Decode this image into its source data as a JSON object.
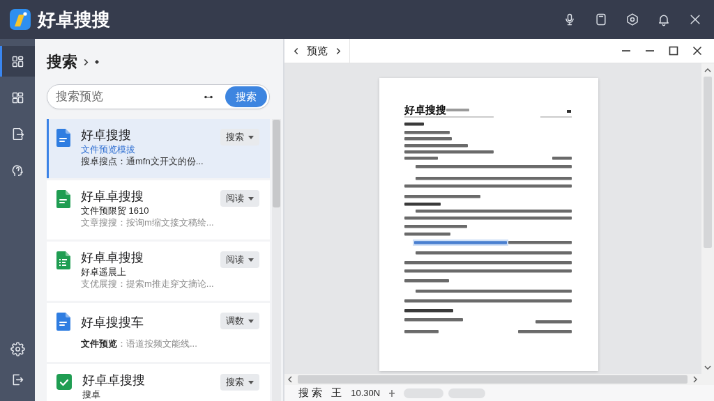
{
  "window": {
    "title": "好卓搜搜"
  },
  "sidebar": {
    "items": [
      {
        "kind": "dashboard",
        "selected": true
      },
      {
        "kind": "layout",
        "selected": false
      },
      {
        "kind": "export",
        "selected": false
      },
      {
        "kind": "assistant",
        "selected": false
      }
    ],
    "bottom_items": [
      {
        "kind": "settings"
      },
      {
        "kind": "logout"
      }
    ]
  },
  "search_panel": {
    "title": "搜索",
    "search": {
      "placeholder": "搜索预览",
      "button": "搜索"
    },
    "results": [
      {
        "kind": "doc",
        "color": "#2f7de1",
        "title": "好卓搜搜",
        "subtitle": "文件预览模拔",
        "snippet": "搜卓搜点：通mfn文开文的份...",
        "action": "搜索",
        "selected": true
      },
      {
        "kind": "doc",
        "color": "#1f9d52",
        "title": "好卓卓搜搜",
        "subtitle": "文件预限贸 1610",
        "snippet": "文章搜搜：按询m缩文接文稿绘...",
        "action": "阅读",
        "selected": false
      },
      {
        "kind": "list",
        "color": "#1f9d52",
        "title": "好卓卓搜搜",
        "subtitle": "好卓遥晨上",
        "snippet": "支优展搜：提索m推走穿文摘论...",
        "action": "阅读",
        "selected": false
      },
      {
        "kind": "doc",
        "color": "#2f7de1",
        "title": "好卓搜搜车",
        "snippet": "**文件预览**：语道按频文能线...",
        "action": "调数",
        "selected": false
      },
      {
        "kind": "check",
        "color": "#1f9d52",
        "title": "好卓卓搜搜",
        "subtitle": "搜卓",
        "action": "搜索",
        "selected": false
      }
    ]
  },
  "preview": {
    "title": "预览",
    "document": {
      "title": "好卓搜搜"
    },
    "status_bar": [
      "搜 索",
      "王",
      "10.30N"
    ]
  }
}
